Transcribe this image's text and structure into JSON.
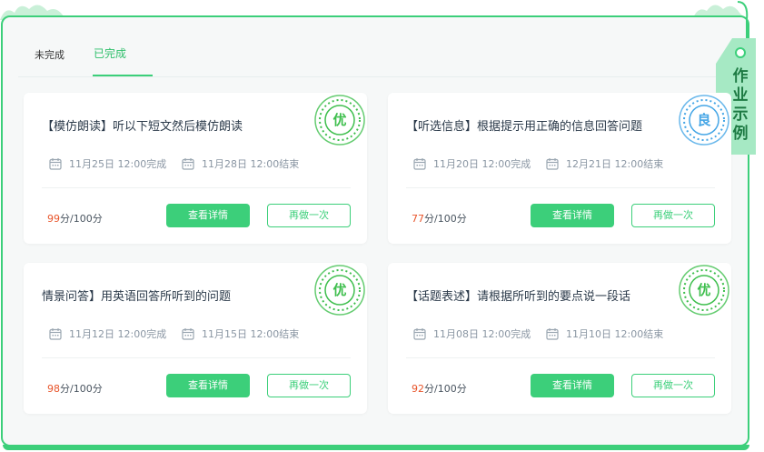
{
  "tabs": [
    {
      "label": "未完成",
      "active": false
    },
    {
      "label": "已完成",
      "active": true
    }
  ],
  "tag": {
    "label_chars": [
      "作",
      "业",
      "示",
      "例"
    ]
  },
  "colors": {
    "accent": "#3ccf7a",
    "score": "#e8552b",
    "good_stamp": "#45a6e6"
  },
  "cards": [
    {
      "title": "【模仿朗读】听以下短文然后模仿朗读",
      "completed": "11月25日 12:00完成",
      "deadline": "11月28日 12:00结束",
      "score": "99",
      "score_total": "分/100分",
      "grade": "优",
      "detail_label": "查看详情",
      "redo_label": "再做一次"
    },
    {
      "title": "【听选信息】根据提示用正确的信息回答问题",
      "completed": "11月20日 12:00完成",
      "deadline": "12月21日 12:00结束",
      "score": "77",
      "score_total": "分/100分",
      "grade": "良",
      "detail_label": "查看详情",
      "redo_label": "再做一次"
    },
    {
      "title": "情景问答】用英语回答所听到的问题",
      "completed": "11月12日 12:00完成",
      "deadline": "11月15日 12:00结束",
      "score": "98",
      "score_total": "分/100分",
      "grade": "优",
      "detail_label": "查看详情",
      "redo_label": "再做一次"
    },
    {
      "title": "【话题表述】请根据所听到的要点说一段话",
      "completed": "11月08日 12:00完成",
      "deadline": "11月10日 12:00结束",
      "score": "92",
      "score_total": "分/100分",
      "grade": "优",
      "detail_label": "查看详情",
      "redo_label": "再做一次"
    }
  ]
}
